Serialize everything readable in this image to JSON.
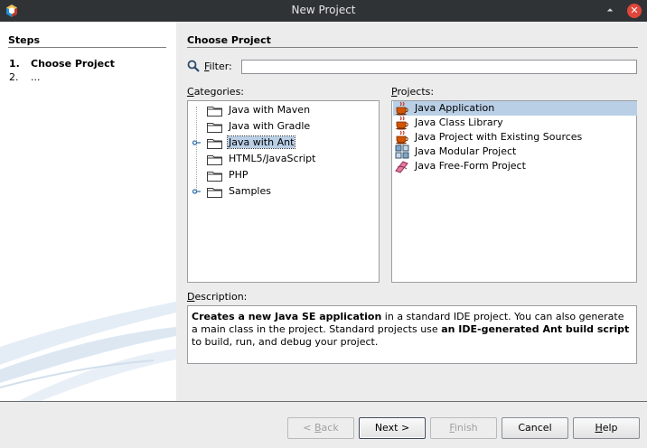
{
  "window": {
    "title": "New Project",
    "minimize_glyph": "⏶",
    "close_glyph": "✕"
  },
  "steps": {
    "title": "Steps",
    "items": [
      {
        "num": "1.",
        "label": "Choose Project"
      },
      {
        "num": "2.",
        "label": "..."
      }
    ]
  },
  "main": {
    "section_title": "Choose Project",
    "filter": {
      "label_hot": "F",
      "label_rest": "ilter:",
      "value": ""
    },
    "categories_label": {
      "hot": "C",
      "rest": "ategories:"
    },
    "projects_label": {
      "hot": "P",
      "rest": "rojects:"
    },
    "categories": [
      {
        "label": "Java with Maven",
        "expandable": false,
        "selected": false
      },
      {
        "label": "Java with Gradle",
        "expandable": false,
        "selected": false
      },
      {
        "label": "Java with Ant",
        "expandable": true,
        "selected": true
      },
      {
        "label": "HTML5/JavaScript",
        "expandable": false,
        "selected": false
      },
      {
        "label": "PHP",
        "expandable": false,
        "selected": false
      },
      {
        "label": "Samples",
        "expandable": true,
        "selected": false
      }
    ],
    "projects": [
      {
        "label": "Java Application",
        "icon": "coffee-cup-icon",
        "selected": true
      },
      {
        "label": "Java Class Library",
        "icon": "coffee-cup-icon",
        "selected": false
      },
      {
        "label": "Java Project with Existing Sources",
        "icon": "coffee-cup-icon",
        "selected": false
      },
      {
        "label": "Java Modular Project",
        "icon": "modules-icon",
        "selected": false
      },
      {
        "label": "Java Free-Form Project",
        "icon": "freeform-icon",
        "selected": false
      }
    ],
    "description_label": {
      "hot": "D",
      "rest": "escription:"
    },
    "description": {
      "b1": "Creates a new Java SE application",
      "t1": " in a standard IDE project. You can also generate a main class in the project. Standard projects use ",
      "b2": "an IDE-generated Ant build script",
      "t2": " to build, run, and debug your project."
    }
  },
  "buttons": {
    "back": {
      "prefix": "< ",
      "hot": "B",
      "rest": "ack"
    },
    "next": {
      "label": "Next >"
    },
    "finish": {
      "hot": "F",
      "rest": "inish"
    },
    "cancel": {
      "label": "Cancel"
    },
    "help": {
      "hot": "H",
      "rest": "elp"
    }
  },
  "colors": {
    "accent_selection": "#b9cfe6",
    "titlebar": "#2f3336",
    "close": "#e0463b"
  }
}
